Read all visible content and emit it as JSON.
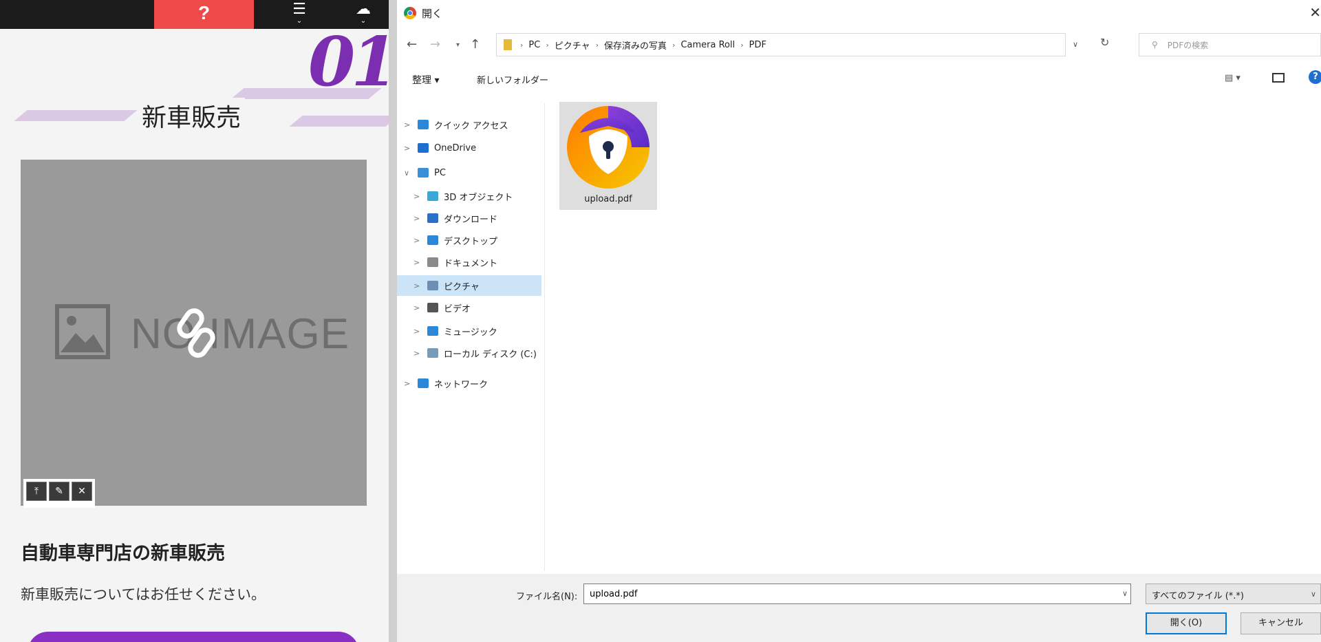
{
  "web_page": {
    "help_button": "?",
    "section_number": "01",
    "heading": "新車販売",
    "image_placeholder": "NO IMAGE",
    "image_tools": [
      "⤒",
      "✎",
      "✕"
    ],
    "card_title": "自動車専門店の新車販売",
    "card_text": "新車販売についてはお任せください。",
    "accent_color": "#7b2fb0"
  },
  "dialog": {
    "title": "開く",
    "address": {
      "crumbs": [
        "PC",
        "ピクチャ",
        "保存済みの写真",
        "Camera Roll",
        "PDF"
      ]
    },
    "search_placeholder": "PDFの検索",
    "toolbar": {
      "organize": "整理 ▾",
      "new_folder": "新しいフォルダー"
    },
    "tree": [
      {
        "label": "クイック アクセス",
        "icon": "star-icon",
        "chevron": ">"
      },
      {
        "label": "OneDrive",
        "icon": "cloud-icon",
        "chevron": ">"
      },
      {
        "label": "PC",
        "icon": "pc-icon",
        "chevron": "∨"
      },
      {
        "label": "3D オブジェクト",
        "icon": "cube-icon",
        "chevron": ">"
      },
      {
        "label": "ダウンロード",
        "icon": "download-icon",
        "chevron": ">"
      },
      {
        "label": "デスクトップ",
        "icon": "desktop-icon",
        "chevron": ">"
      },
      {
        "label": "ドキュメント",
        "icon": "document-icon",
        "chevron": ">"
      },
      {
        "label": "ピクチャ",
        "icon": "pictures-icon",
        "chevron": ">",
        "selected": true
      },
      {
        "label": "ビデオ",
        "icon": "video-icon",
        "chevron": ">"
      },
      {
        "label": "ミュージック",
        "icon": "music-icon",
        "chevron": ">"
      },
      {
        "label": "ローカル ディスク (C:)",
        "icon": "disk-icon",
        "chevron": ">"
      },
      {
        "label": "ネットワーク",
        "icon": "network-icon",
        "chevron": ">"
      }
    ],
    "file": {
      "name": "upload.pdf",
      "icon": "avast-secure-browser-icon"
    },
    "filename_label": "ファイル名(N):",
    "filename_value": "upload.pdf",
    "filetype": "すべてのファイル (*.*)",
    "open_button": "開く(O)",
    "cancel_button": "キャンセル"
  }
}
